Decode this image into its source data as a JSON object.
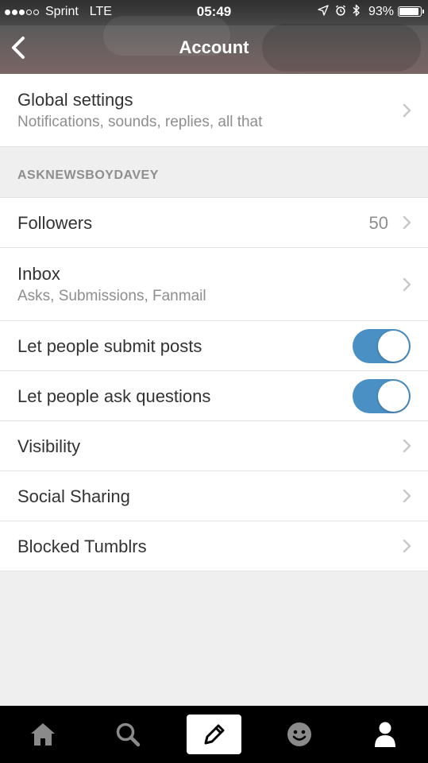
{
  "status_bar": {
    "carrier": "Sprint",
    "network": "LTE",
    "time": "05:49",
    "battery_percent_label": "93%",
    "battery_level": 0.93,
    "signal_bars": 3,
    "signal_total": 5
  },
  "nav": {
    "title": "Account",
    "back_icon": "chevron-left-icon"
  },
  "global_settings": {
    "title": "Global settings",
    "subtitle": "Notifications, sounds, replies, all that"
  },
  "blog_section": {
    "header": "ASKNEWSBOYDAVEY",
    "followers": {
      "title": "Followers",
      "count": "50"
    },
    "inbox": {
      "title": "Inbox",
      "subtitle": "Asks, Submissions, Fanmail"
    },
    "submit_posts": {
      "title": "Let people submit posts",
      "enabled": true
    },
    "ask_questions": {
      "title": "Let people ask questions",
      "enabled": true
    },
    "visibility": {
      "title": "Visibility"
    },
    "social_sharing": {
      "title": "Social Sharing"
    },
    "blocked": {
      "title": "Blocked Tumblrs"
    }
  },
  "tab_bar": {
    "tabs": [
      "home-icon",
      "search-icon",
      "compose-icon",
      "activity-icon",
      "account-icon"
    ],
    "active": "account-icon"
  },
  "colors": {
    "toggle_on": "#4a90c4",
    "background": "#efefef",
    "tab_bar": "#000000"
  }
}
